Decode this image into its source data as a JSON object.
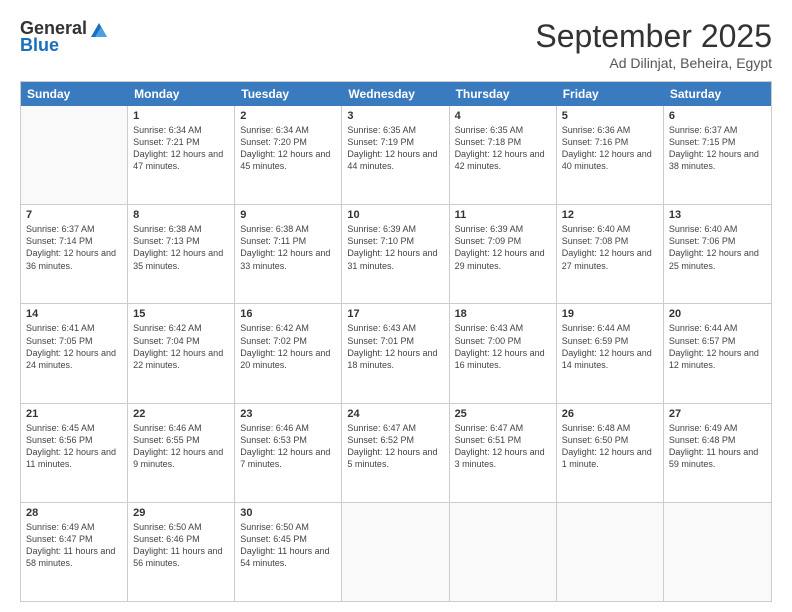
{
  "header": {
    "logo_general": "General",
    "logo_blue": "Blue",
    "month": "September 2025",
    "location": "Ad Dilinjat, Beheira, Egypt"
  },
  "days_of_week": [
    "Sunday",
    "Monday",
    "Tuesday",
    "Wednesday",
    "Thursday",
    "Friday",
    "Saturday"
  ],
  "weeks": [
    [
      {
        "day": "",
        "empty": true
      },
      {
        "day": "1",
        "sunrise": "Sunrise: 6:34 AM",
        "sunset": "Sunset: 7:21 PM",
        "daylight": "Daylight: 12 hours and 47 minutes."
      },
      {
        "day": "2",
        "sunrise": "Sunrise: 6:34 AM",
        "sunset": "Sunset: 7:20 PM",
        "daylight": "Daylight: 12 hours and 45 minutes."
      },
      {
        "day": "3",
        "sunrise": "Sunrise: 6:35 AM",
        "sunset": "Sunset: 7:19 PM",
        "daylight": "Daylight: 12 hours and 44 minutes."
      },
      {
        "day": "4",
        "sunrise": "Sunrise: 6:35 AM",
        "sunset": "Sunset: 7:18 PM",
        "daylight": "Daylight: 12 hours and 42 minutes."
      },
      {
        "day": "5",
        "sunrise": "Sunrise: 6:36 AM",
        "sunset": "Sunset: 7:16 PM",
        "daylight": "Daylight: 12 hours and 40 minutes."
      },
      {
        "day": "6",
        "sunrise": "Sunrise: 6:37 AM",
        "sunset": "Sunset: 7:15 PM",
        "daylight": "Daylight: 12 hours and 38 minutes."
      }
    ],
    [
      {
        "day": "7",
        "sunrise": "Sunrise: 6:37 AM",
        "sunset": "Sunset: 7:14 PM",
        "daylight": "Daylight: 12 hours and 36 minutes."
      },
      {
        "day": "8",
        "sunrise": "Sunrise: 6:38 AM",
        "sunset": "Sunset: 7:13 PM",
        "daylight": "Daylight: 12 hours and 35 minutes."
      },
      {
        "day": "9",
        "sunrise": "Sunrise: 6:38 AM",
        "sunset": "Sunset: 7:11 PM",
        "daylight": "Daylight: 12 hours and 33 minutes."
      },
      {
        "day": "10",
        "sunrise": "Sunrise: 6:39 AM",
        "sunset": "Sunset: 7:10 PM",
        "daylight": "Daylight: 12 hours and 31 minutes."
      },
      {
        "day": "11",
        "sunrise": "Sunrise: 6:39 AM",
        "sunset": "Sunset: 7:09 PM",
        "daylight": "Daylight: 12 hours and 29 minutes."
      },
      {
        "day": "12",
        "sunrise": "Sunrise: 6:40 AM",
        "sunset": "Sunset: 7:08 PM",
        "daylight": "Daylight: 12 hours and 27 minutes."
      },
      {
        "day": "13",
        "sunrise": "Sunrise: 6:40 AM",
        "sunset": "Sunset: 7:06 PM",
        "daylight": "Daylight: 12 hours and 25 minutes."
      }
    ],
    [
      {
        "day": "14",
        "sunrise": "Sunrise: 6:41 AM",
        "sunset": "Sunset: 7:05 PM",
        "daylight": "Daylight: 12 hours and 24 minutes."
      },
      {
        "day": "15",
        "sunrise": "Sunrise: 6:42 AM",
        "sunset": "Sunset: 7:04 PM",
        "daylight": "Daylight: 12 hours and 22 minutes."
      },
      {
        "day": "16",
        "sunrise": "Sunrise: 6:42 AM",
        "sunset": "Sunset: 7:02 PM",
        "daylight": "Daylight: 12 hours and 20 minutes."
      },
      {
        "day": "17",
        "sunrise": "Sunrise: 6:43 AM",
        "sunset": "Sunset: 7:01 PM",
        "daylight": "Daylight: 12 hours and 18 minutes."
      },
      {
        "day": "18",
        "sunrise": "Sunrise: 6:43 AM",
        "sunset": "Sunset: 7:00 PM",
        "daylight": "Daylight: 12 hours and 16 minutes."
      },
      {
        "day": "19",
        "sunrise": "Sunrise: 6:44 AM",
        "sunset": "Sunset: 6:59 PM",
        "daylight": "Daylight: 12 hours and 14 minutes."
      },
      {
        "day": "20",
        "sunrise": "Sunrise: 6:44 AM",
        "sunset": "Sunset: 6:57 PM",
        "daylight": "Daylight: 12 hours and 12 minutes."
      }
    ],
    [
      {
        "day": "21",
        "sunrise": "Sunrise: 6:45 AM",
        "sunset": "Sunset: 6:56 PM",
        "daylight": "Daylight: 12 hours and 11 minutes."
      },
      {
        "day": "22",
        "sunrise": "Sunrise: 6:46 AM",
        "sunset": "Sunset: 6:55 PM",
        "daylight": "Daylight: 12 hours and 9 minutes."
      },
      {
        "day": "23",
        "sunrise": "Sunrise: 6:46 AM",
        "sunset": "Sunset: 6:53 PM",
        "daylight": "Daylight: 12 hours and 7 minutes."
      },
      {
        "day": "24",
        "sunrise": "Sunrise: 6:47 AM",
        "sunset": "Sunset: 6:52 PM",
        "daylight": "Daylight: 12 hours and 5 minutes."
      },
      {
        "day": "25",
        "sunrise": "Sunrise: 6:47 AM",
        "sunset": "Sunset: 6:51 PM",
        "daylight": "Daylight: 12 hours and 3 minutes."
      },
      {
        "day": "26",
        "sunrise": "Sunrise: 6:48 AM",
        "sunset": "Sunset: 6:50 PM",
        "daylight": "Daylight: 12 hours and 1 minute."
      },
      {
        "day": "27",
        "sunrise": "Sunrise: 6:49 AM",
        "sunset": "Sunset: 6:48 PM",
        "daylight": "Daylight: 11 hours and 59 minutes."
      }
    ],
    [
      {
        "day": "28",
        "sunrise": "Sunrise: 6:49 AM",
        "sunset": "Sunset: 6:47 PM",
        "daylight": "Daylight: 11 hours and 58 minutes."
      },
      {
        "day": "29",
        "sunrise": "Sunrise: 6:50 AM",
        "sunset": "Sunset: 6:46 PM",
        "daylight": "Daylight: 11 hours and 56 minutes."
      },
      {
        "day": "30",
        "sunrise": "Sunrise: 6:50 AM",
        "sunset": "Sunset: 6:45 PM",
        "daylight": "Daylight: 11 hours and 54 minutes."
      },
      {
        "day": "",
        "empty": true
      },
      {
        "day": "",
        "empty": true
      },
      {
        "day": "",
        "empty": true
      },
      {
        "day": "",
        "empty": true
      }
    ]
  ]
}
